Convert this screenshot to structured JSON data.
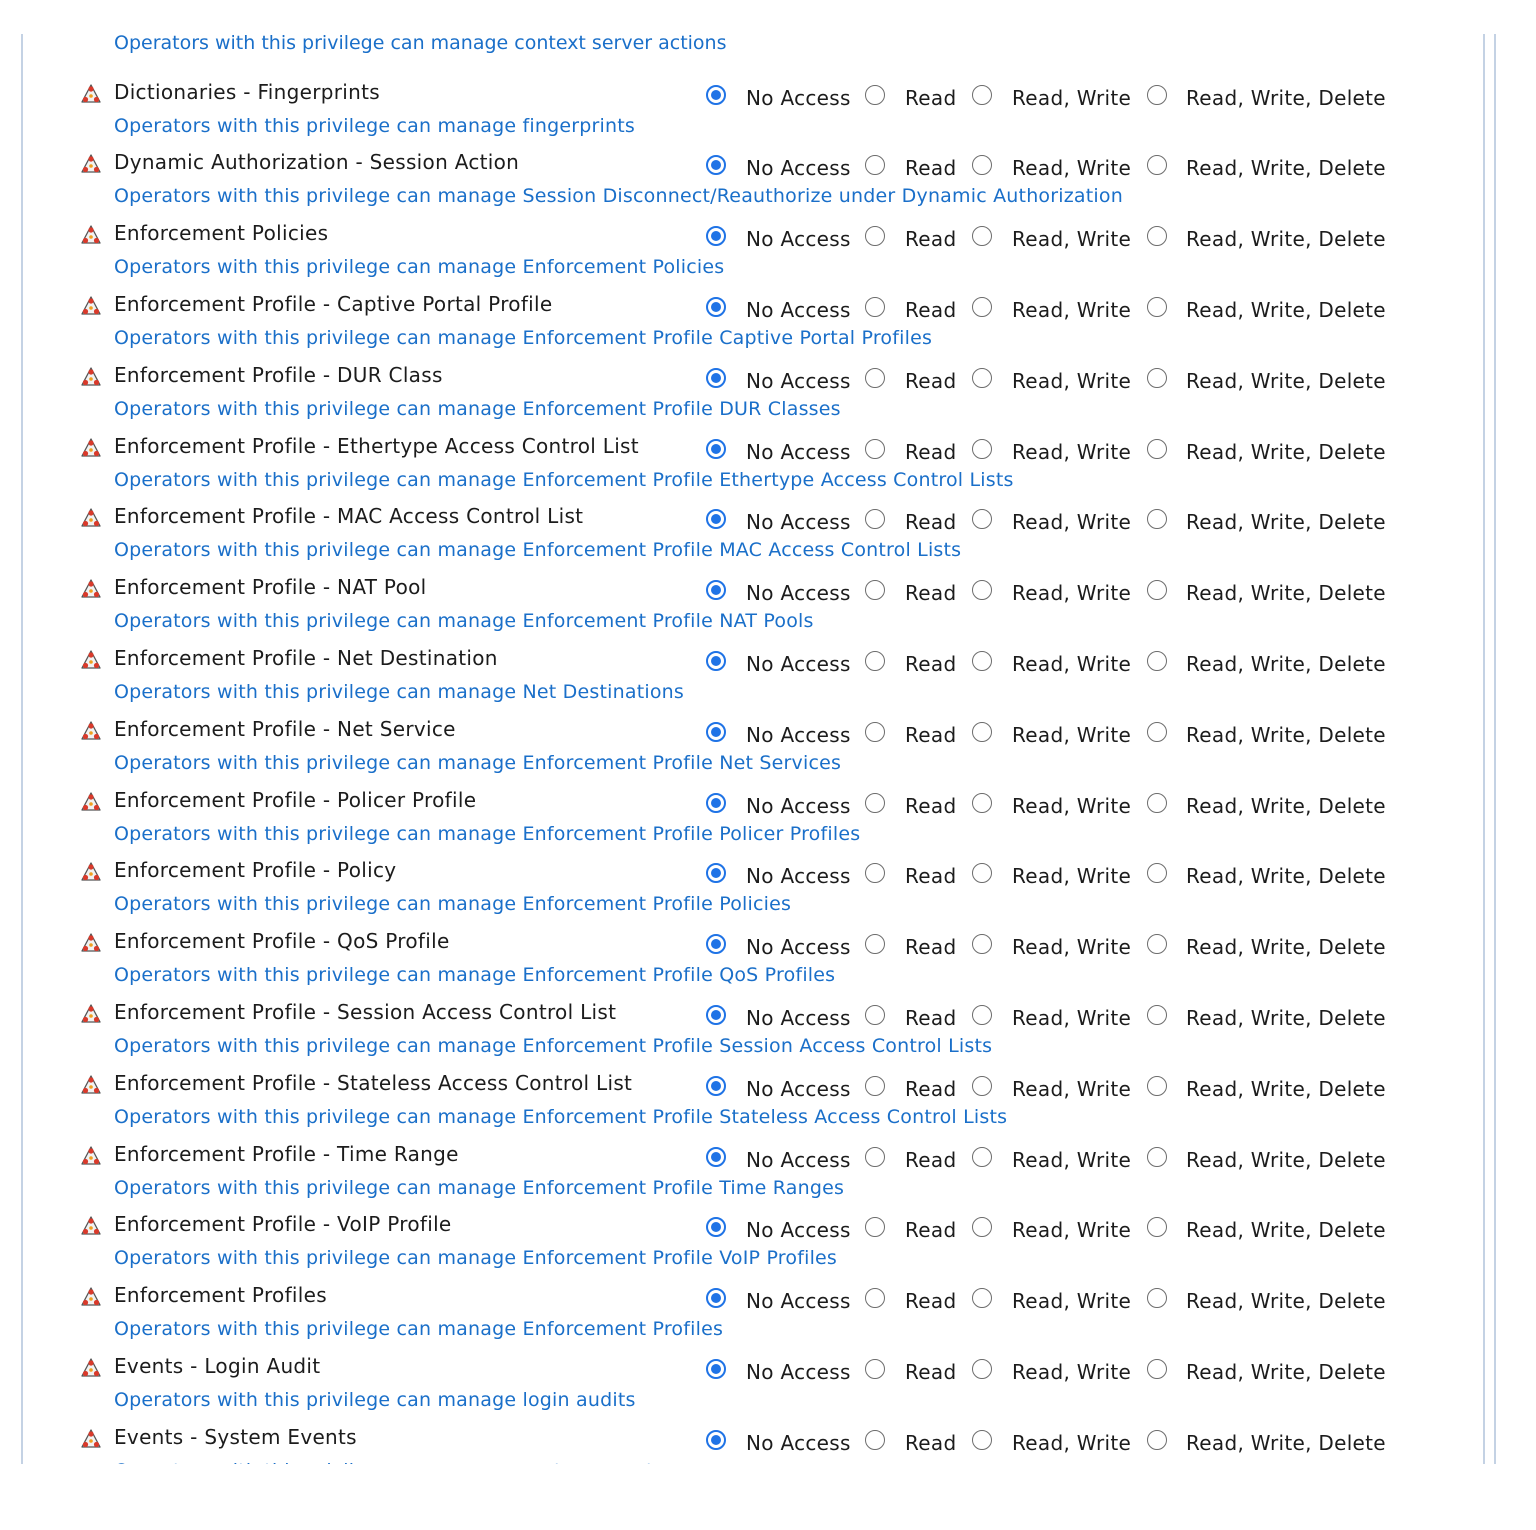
{
  "top_description": "Operators with this privilege can manage context server actions",
  "options": [
    "No Access",
    "Read",
    "Read, Write",
    "Read, Write, Delete"
  ],
  "privileges": [
    {
      "name": "Dictionaries - Fingerprints",
      "description": "Operators with this privilege can manage fingerprints",
      "selected": "No Access"
    },
    {
      "name": "Dynamic Authorization - Session Action",
      "description": "Operators with this privilege can manage Session Disconnect/Reauthorize under Dynamic Authorization",
      "selected": "No Access"
    },
    {
      "name": "Enforcement Policies",
      "description": "Operators with this privilege can manage Enforcement Policies",
      "selected": "No Access"
    },
    {
      "name": "Enforcement Profile - Captive Portal Profile",
      "description": "Operators with this privilege can manage Enforcement Profile Captive Portal Profiles",
      "selected": "No Access"
    },
    {
      "name": "Enforcement Profile - DUR Class",
      "description": "Operators with this privilege can manage Enforcement Profile DUR Classes",
      "selected": "No Access"
    },
    {
      "name": "Enforcement Profile - Ethertype Access Control List",
      "description": "Operators with this privilege can manage Enforcement Profile Ethertype Access Control Lists",
      "selected": "No Access"
    },
    {
      "name": "Enforcement Profile - MAC Access Control List",
      "description": "Operators with this privilege can manage Enforcement Profile MAC Access Control Lists",
      "selected": "No Access"
    },
    {
      "name": "Enforcement Profile - NAT Pool",
      "description": "Operators with this privilege can manage Enforcement Profile NAT Pools",
      "selected": "No Access"
    },
    {
      "name": "Enforcement Profile - Net Destination",
      "description": "Operators with this privilege can manage Net Destinations",
      "selected": "No Access"
    },
    {
      "name": "Enforcement Profile - Net Service",
      "description": "Operators with this privilege can manage Enforcement Profile Net Services",
      "selected": "No Access"
    },
    {
      "name": "Enforcement Profile - Policer Profile",
      "description": "Operators with this privilege can manage Enforcement Profile Policer Profiles",
      "selected": "No Access"
    },
    {
      "name": "Enforcement Profile - Policy",
      "description": "Operators with this privilege can manage Enforcement Profile Policies",
      "selected": "No Access"
    },
    {
      "name": "Enforcement Profile - QoS Profile",
      "description": "Operators with this privilege can manage Enforcement Profile QoS Profiles",
      "selected": "No Access"
    },
    {
      "name": "Enforcement Profile - Session Access Control List",
      "description": "Operators with this privilege can manage Enforcement Profile Session Access Control Lists",
      "selected": "No Access"
    },
    {
      "name": "Enforcement Profile - Stateless Access Control List",
      "description": "Operators with this privilege can manage Enforcement Profile Stateless Access Control Lists",
      "selected": "No Access"
    },
    {
      "name": "Enforcement Profile - Time Range",
      "description": "Operators with this privilege can manage Enforcement Profile Time Ranges",
      "selected": "No Access"
    },
    {
      "name": "Enforcement Profile - VoIP Profile",
      "description": "Operators with this privilege can manage Enforcement Profile VoIP Profiles",
      "selected": "No Access"
    },
    {
      "name": "Enforcement Profiles",
      "description": "Operators with this privilege can manage Enforcement Profiles",
      "selected": "No Access"
    },
    {
      "name": "Events - Login Audit",
      "description": "Operators with this privilege can manage login audits",
      "selected": "No Access"
    },
    {
      "name": "Events - System Events",
      "description": "Operators with this privilege can manage system events",
      "selected": "No Access"
    }
  ],
  "colors": {
    "link": "#1a6fc9",
    "radio_selected": "#1f73e6",
    "border": "#c4d2e4"
  }
}
